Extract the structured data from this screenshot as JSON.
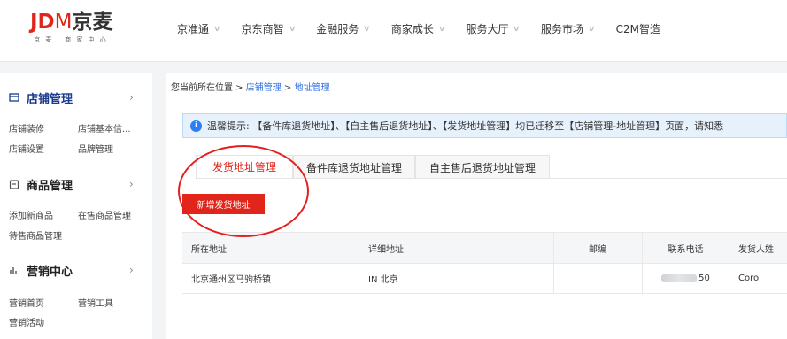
{
  "logo": {
    "jd": "JD",
    "m": "M",
    "cn": "京麦",
    "subtitle": "京 麦 · 商 家 中 心"
  },
  "nav": [
    {
      "label": "京准通",
      "has_dropdown": true
    },
    {
      "label": "京东商智",
      "has_dropdown": true
    },
    {
      "label": "金融服务",
      "has_dropdown": true
    },
    {
      "label": "商家成长",
      "has_dropdown": true
    },
    {
      "label": "服务大厅",
      "has_dropdown": true
    },
    {
      "label": "服务市场",
      "has_dropdown": true
    },
    {
      "label": "C2M智造",
      "has_dropdown": false
    }
  ],
  "sidebar": {
    "sections": [
      {
        "title": "店铺管理",
        "icon": "shop-icon",
        "active": true,
        "items": [
          "店铺装修",
          "店铺基本信...",
          "店铺设置",
          "品牌管理"
        ]
      },
      {
        "title": "商品管理",
        "icon": "goods-icon",
        "active": false,
        "items": [
          "添加新商品",
          "在售商品管理",
          "待售商品管理"
        ]
      },
      {
        "title": "营销中心",
        "icon": "chart-icon",
        "active": false,
        "items": [
          "营销首页",
          "营销工具",
          "营销活动"
        ]
      }
    ],
    "arrow": "›"
  },
  "breadcrumb": {
    "prefix": "您当前所在位置 > ",
    "level1": "店铺管理",
    "sep": " > ",
    "level2": "地址管理"
  },
  "notice": {
    "icon": "info-icon",
    "text": "温馨提示: 【备件库退货地址】、【自主售后退货地址】、【发货地址管理】均已迁移至【店铺管理-地址管理】页面，请知悉"
  },
  "tabs": [
    {
      "label": "发货地址管理",
      "active": true
    },
    {
      "label": "备件库退货地址管理",
      "active": false
    },
    {
      "label": "自主售后退货地址管理",
      "active": false
    }
  ],
  "add_button": "新增发货地址",
  "table": {
    "headers": [
      "所在地址",
      "详细地址",
      "邮编",
      "联系电话",
      "发货人姓"
    ],
    "rows": [
      {
        "address": "北京通州区马驹桥镇",
        "detail": "IN 北京",
        "zip": "",
        "phone_suffix": "50",
        "sender": "Corol"
      }
    ]
  },
  "colors": {
    "brand_red": "#e1251b",
    "link_blue": "#2b6de0",
    "notice_bg": "#e6f1fc",
    "annotation_red": "#e51f1f"
  }
}
